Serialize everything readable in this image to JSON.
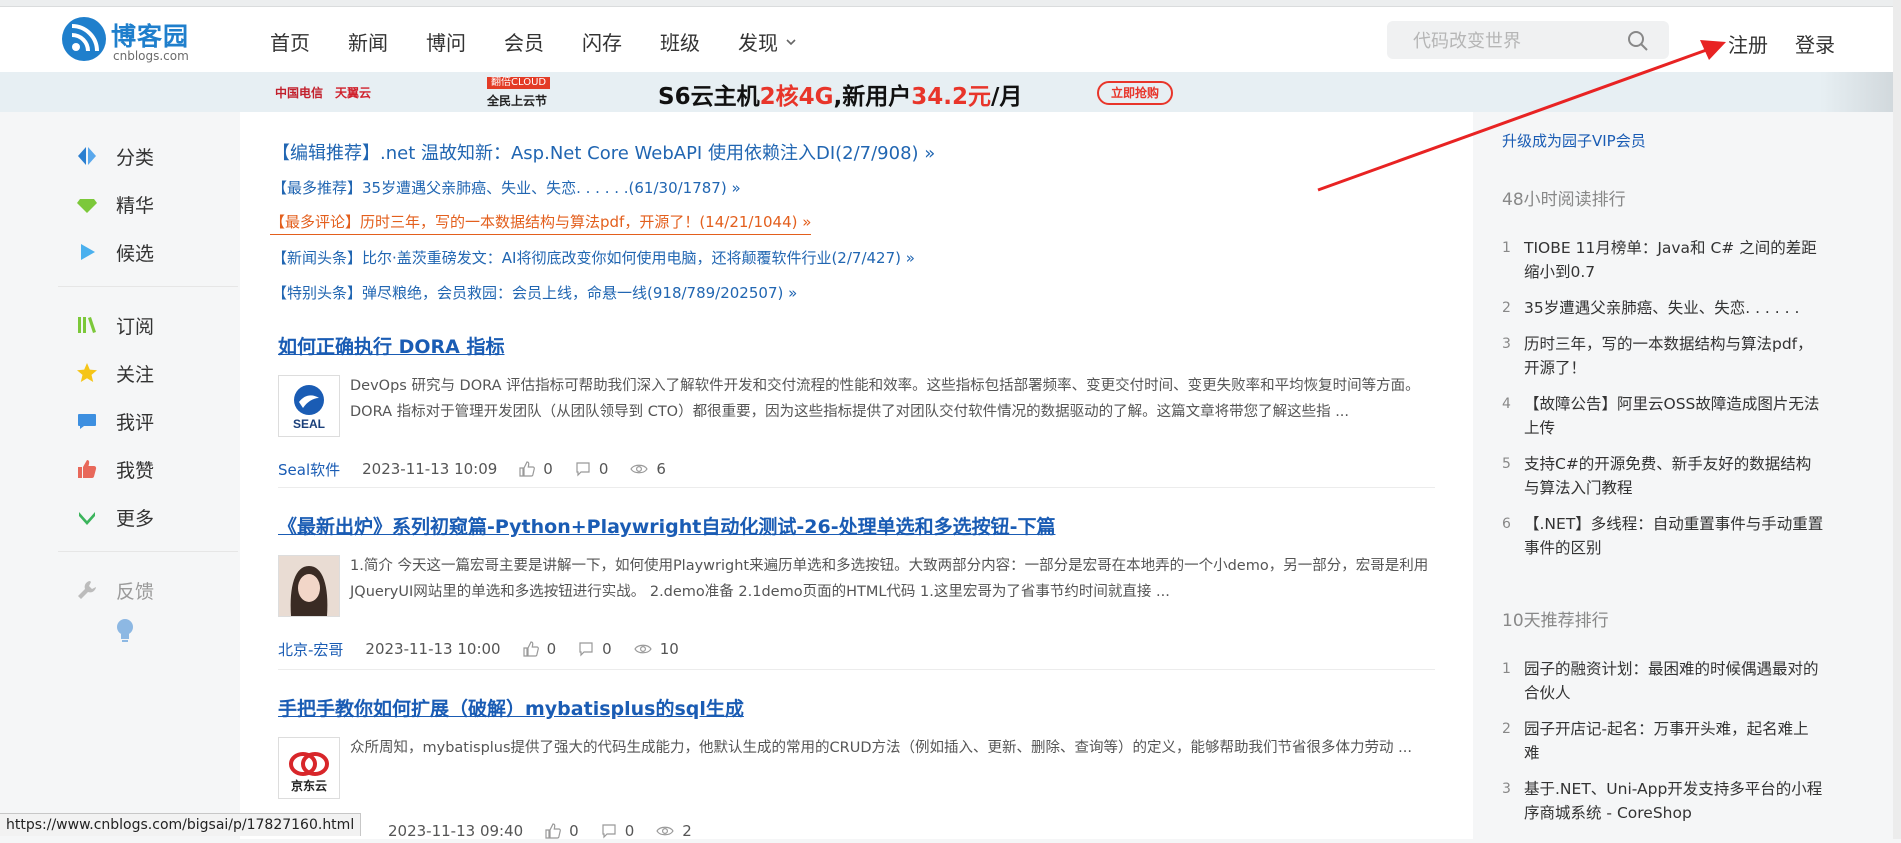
{
  "header": {
    "logo_text": "博客园",
    "logo_sub": "cnblogs.com",
    "nav": [
      "首页",
      "新闻",
      "博问",
      "会员",
      "闪存",
      "班级",
      "发现"
    ],
    "search_placeholder": "代码改变世界",
    "register": "注册",
    "login": "登录"
  },
  "banner": {
    "carrier1": "中国电信",
    "carrier2": "天翼云",
    "promo_badge": "翻倍CLOUD",
    "promo_sub": "全民上云节",
    "headline_a": "S6云主机",
    "headline_b": "2核4G",
    "headline_c": ",新用户",
    "headline_d": "34.2元",
    "headline_e": "/月",
    "buy": "立即抢购"
  },
  "sidebar": {
    "items": [
      {
        "label": "分类"
      },
      {
        "label": "精华"
      },
      {
        "label": "候选"
      },
      {
        "label": "订阅"
      },
      {
        "label": "关注"
      },
      {
        "label": "我评"
      },
      {
        "label": "我赞"
      },
      {
        "label": "更多"
      },
      {
        "label": "反馈"
      }
    ]
  },
  "recommendations": [
    "【编辑推荐】.net 温故知新：Asp.Net Core WebAPI 使用依赖注入DI(2/7/908) »",
    "【最多推荐】35岁遭遇父亲肺癌、失业、失恋. . . . . .(61/30/1787) »",
    "【最多评论】历时三年，写的一本数据结构与算法pdf，开源了！(14/21/1044) »",
    "【新闻头条】比尔·盖茨重磅发文：AI将彻底改变你如何使用电脑，还将颠覆软件行业(2/7/427) »",
    "【特别头条】弹尽粮绝，会员救园：会员上线，命悬一线(918/789/202507) »"
  ],
  "posts": [
    {
      "title": "如何正确执行 DORA 指标",
      "thumb_text": "SEAL",
      "summary": "DevOps 研究与 DORA 评估指标可帮助我们深入了解软件开发和交付流程的性能和效率。这些指标包括部署频率、变更交付时间、变更失败率和平均恢复时间等方面。DORA 指标对于管理开发团队（从团队领导到 CTO）都很重要，因为这些指标提供了对团队交付软件情况的数据驱动的了解。这篇文章将带您了解这些指 ...",
      "author": "Seal软件",
      "date": "2023-11-13 10:09",
      "likes": "0",
      "comments": "0",
      "views": "6"
    },
    {
      "title": "《最新出炉》系列初窥篇-Python+Playwright自动化测试-26-处理单选和多选按钮-下篇",
      "thumb_text": "",
      "summary": "1.简介 今天这一篇宏哥主要是讲解一下，如何使用Playwright来遍历单选和多选按钮。大致两部分内容：一部分是宏哥在本地弄的一个小demo，另一部分，宏哥是利用JQueryUI网站里的单选和多选按钮进行实战。 2.demo准备 2.1demo页面的HTML代码 1.这里宏哥为了省事节约时间就直接 ...",
      "author": "北京-宏哥",
      "date": "2023-11-13 10:00",
      "likes": "0",
      "comments": "0",
      "views": "10"
    },
    {
      "title": "手把手教你如何扩展（破解）mybatisplus的sql生成",
      "thumb_text": "京东云",
      "summary": "众所周知，mybatisplus提供了强大的代码生成能力，他默认生成的常用的CRUD方法（例如插入、更新、删除、查询等）的定义，能够帮助我们节省很多体力劳动 ...",
      "author": "",
      "date": "2023-11-13 09:40",
      "likes": "0",
      "comments": "0",
      "views": "2"
    }
  ],
  "right": {
    "vip": "升级成为园子VIP会员",
    "section1": "48小时阅读排行",
    "list1": [
      "TIOBE 11月榜单：Java和 C# 之间的差距缩小到0.7",
      "35岁遭遇父亲肺癌、失业、失恋. . . . . .",
      "历时三年，写的一本数据结构与算法pdf，开源了！",
      "【故障公告】阿里云OSS故障造成图片无法上传",
      "支持C#的开源免费、新手友好的数据结构与算法入门教程",
      "【.NET】多线程：自动重置事件与手动重置事件的区别"
    ],
    "section2": "10天推荐排行",
    "list2": [
      "园子的融资计划：最困难的时候偶遇最对的合伙人",
      "园子开店记-起名：万事开头难，起名难上难",
      "基于.NET、Uni-App开发支持多平台的小程序商城系统 - CoreShop"
    ]
  },
  "status_url": "https://www.cnblogs.com/bigsai/p/17827160.html",
  "colors": {
    "brand": "#1f7fcc",
    "link": "#1a5cb4",
    "accent_red": "#e8352a",
    "orange": "#e35f1d"
  }
}
